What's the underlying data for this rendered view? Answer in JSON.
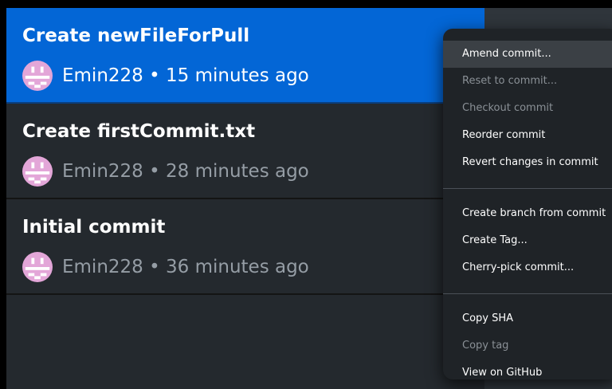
{
  "commits": [
    {
      "title": "Create newFileForPull",
      "meta": "Emin228 • 15 minutes ago",
      "selected": true
    },
    {
      "title": "Create firstCommit.txt",
      "meta": "Emin228 • 28 minutes ago",
      "selected": false
    },
    {
      "title": "Initial commit",
      "meta": "Emin228 • 36 minutes ago",
      "selected": false
    }
  ],
  "menu": {
    "group1": [
      {
        "label": "Amend commit...",
        "enabled": true,
        "hovered": true
      },
      {
        "label": "Reset to commit...",
        "enabled": false
      },
      {
        "label": "Checkout commit",
        "enabled": false
      },
      {
        "label": "Reorder commit",
        "enabled": true
      },
      {
        "label": "Revert changes in commit",
        "enabled": true
      }
    ],
    "group2": [
      {
        "label": "Create branch from commit",
        "enabled": true
      },
      {
        "label": "Create Tag...",
        "enabled": true
      },
      {
        "label": "Cherry-pick commit...",
        "enabled": true
      }
    ],
    "group3": [
      {
        "label": "Copy SHA",
        "enabled": true
      },
      {
        "label": "Copy tag",
        "enabled": false
      },
      {
        "label": "View on GitHub",
        "enabled": true
      }
    ]
  },
  "colors": {
    "selected_row": "#0366d6",
    "list_bg": "#24292e",
    "menu_bg": "#1f2327",
    "avatar_pink": "#e3a6d8"
  }
}
